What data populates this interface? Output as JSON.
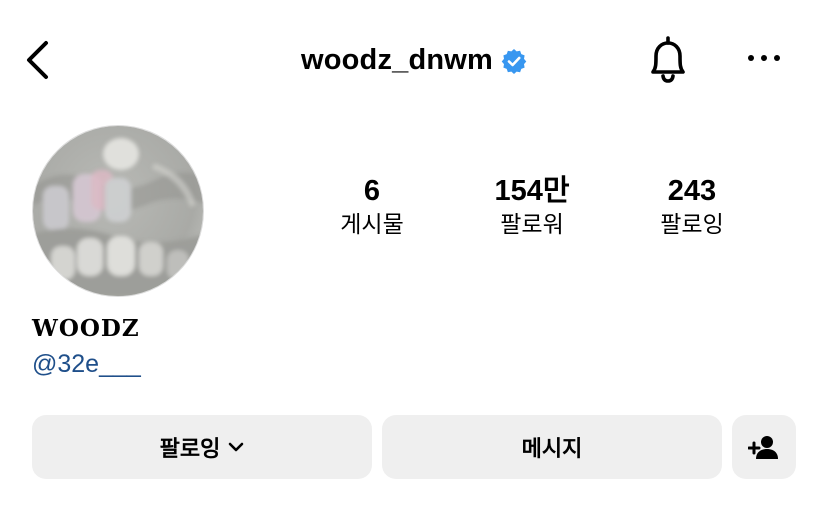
{
  "header": {
    "username": "woodz_dnwm",
    "verified_color": "#3897f0",
    "back_icon": "chevron-left-icon",
    "bell_icon": "bell-icon",
    "more_icon": "more-horizontal-icon"
  },
  "profile": {
    "display_name": "WOODZ",
    "handle": "@32e___"
  },
  "stats": {
    "posts": {
      "value": "6",
      "label": "게시물"
    },
    "followers": {
      "value": "154만",
      "label": "팔로워"
    },
    "following": {
      "value": "243",
      "label": "팔로잉"
    }
  },
  "actions": {
    "following_label": "팔로잉",
    "message_label": "메시지",
    "add_user_icon": "add-user-icon"
  }
}
